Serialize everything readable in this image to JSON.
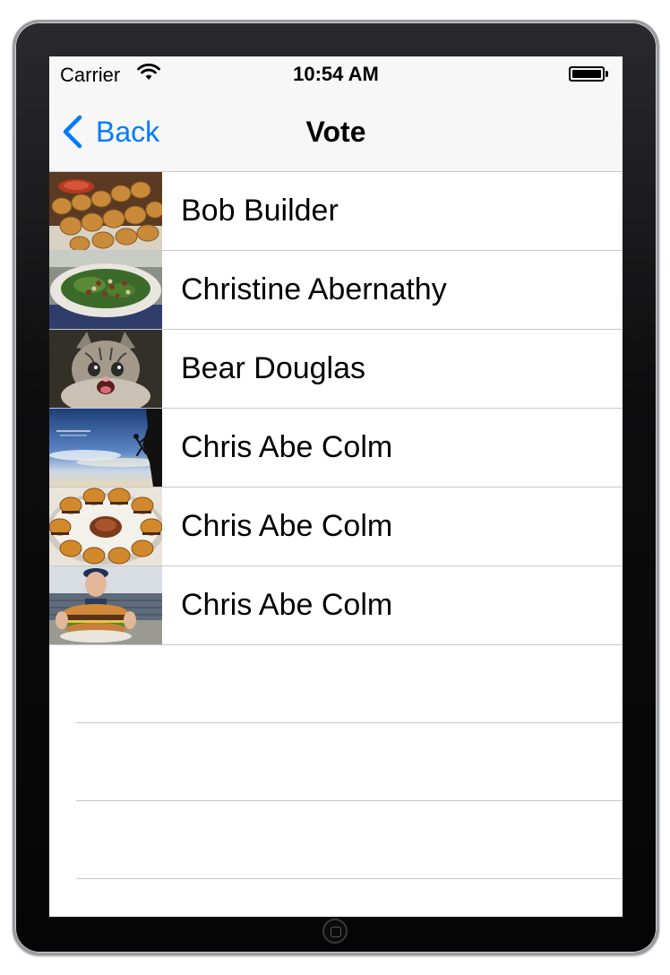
{
  "status_bar": {
    "carrier": "Carrier",
    "time": "10:54 AM",
    "wifi_icon": "wifi-icon",
    "battery_icon": "battery-full-icon"
  },
  "nav_bar": {
    "back_label": "Back",
    "title": "Vote",
    "back_icon": "chevron-left-icon",
    "tint_color": "#007aff"
  },
  "rows": [
    {
      "label": "Bob Builder",
      "image": "chicken-nuggets-photo"
    },
    {
      "label": "Christine Abernathy",
      "image": "salad-photo"
    },
    {
      "label": "Bear Douglas",
      "image": "kitten-photo"
    },
    {
      "label": "Chris Abe Colm",
      "image": "rock-climber-photo"
    },
    {
      "label": "Chris Abe Colm",
      "image": "slider-burgers-photo"
    },
    {
      "label": "Chris Abe Colm",
      "image": "giant-burger-photo"
    }
  ],
  "colors": {
    "separator": "#c8c7cc",
    "bar_background": "#f7f7f7"
  }
}
